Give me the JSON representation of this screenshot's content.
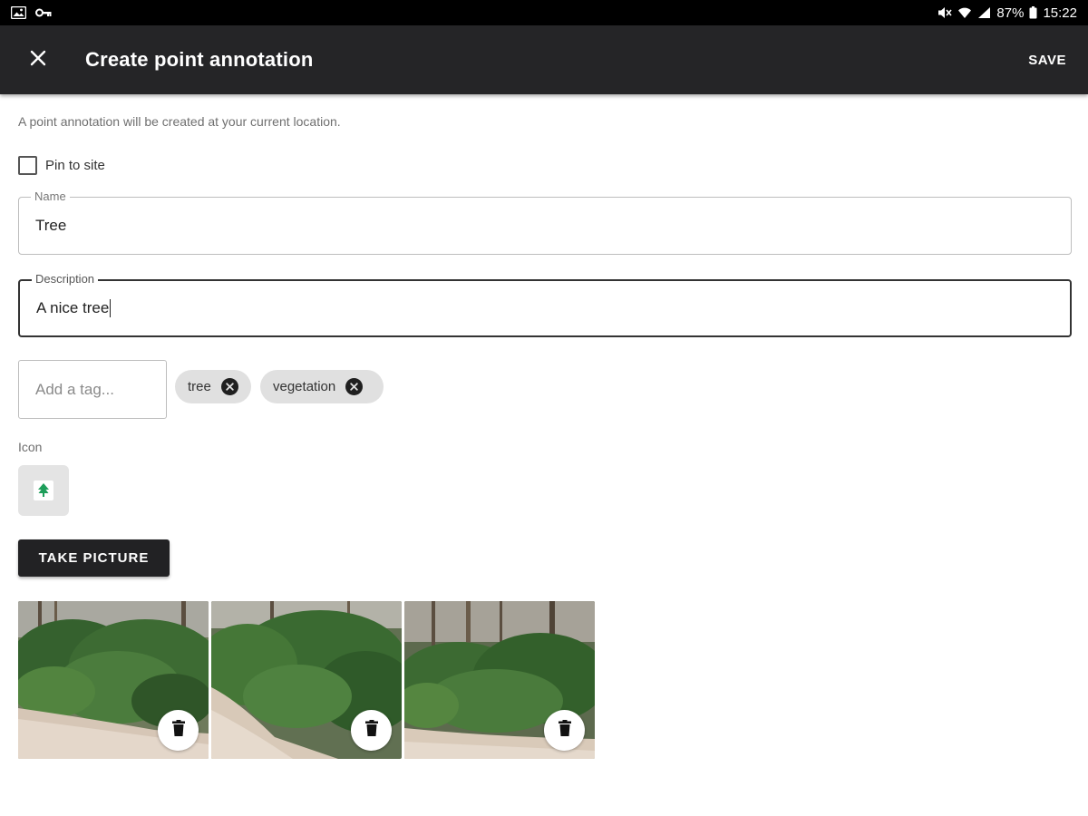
{
  "status_bar": {
    "left_icons": [
      "image-icon",
      "key-icon"
    ],
    "right_icons": [
      "mute-icon",
      "wifi-icon",
      "signal-icon",
      "battery-icon"
    ],
    "battery": "87%",
    "time": "15:22"
  },
  "app_bar": {
    "title": "Create point annotation",
    "save_label": "SAVE",
    "close_icon": "close-icon"
  },
  "form": {
    "hint": "A point annotation will be created at your current location.",
    "pin": {
      "label": "Pin to site",
      "checked": false
    },
    "name": {
      "label": "Name",
      "value": "Tree"
    },
    "description": {
      "label": "Description",
      "value": "A nice tree"
    },
    "tag_input": {
      "placeholder": "Add a tag..."
    },
    "tags": [
      "tree",
      "vegetation"
    ],
    "icon": {
      "label": "Icon",
      "selected": "tree-icon"
    },
    "take_picture_label": "TAKE PICTURE",
    "photos": [
      {
        "delete_icon": "trash-icon"
      },
      {
        "delete_icon": "trash-icon"
      },
      {
        "delete_icon": "trash-icon"
      }
    ]
  },
  "colors": {
    "status_bar": "#000000",
    "app_bar": "#252527",
    "chip_bg": "#e0e0e0",
    "button_bg": "#222224",
    "tree_icon": "#1e9e5a"
  }
}
